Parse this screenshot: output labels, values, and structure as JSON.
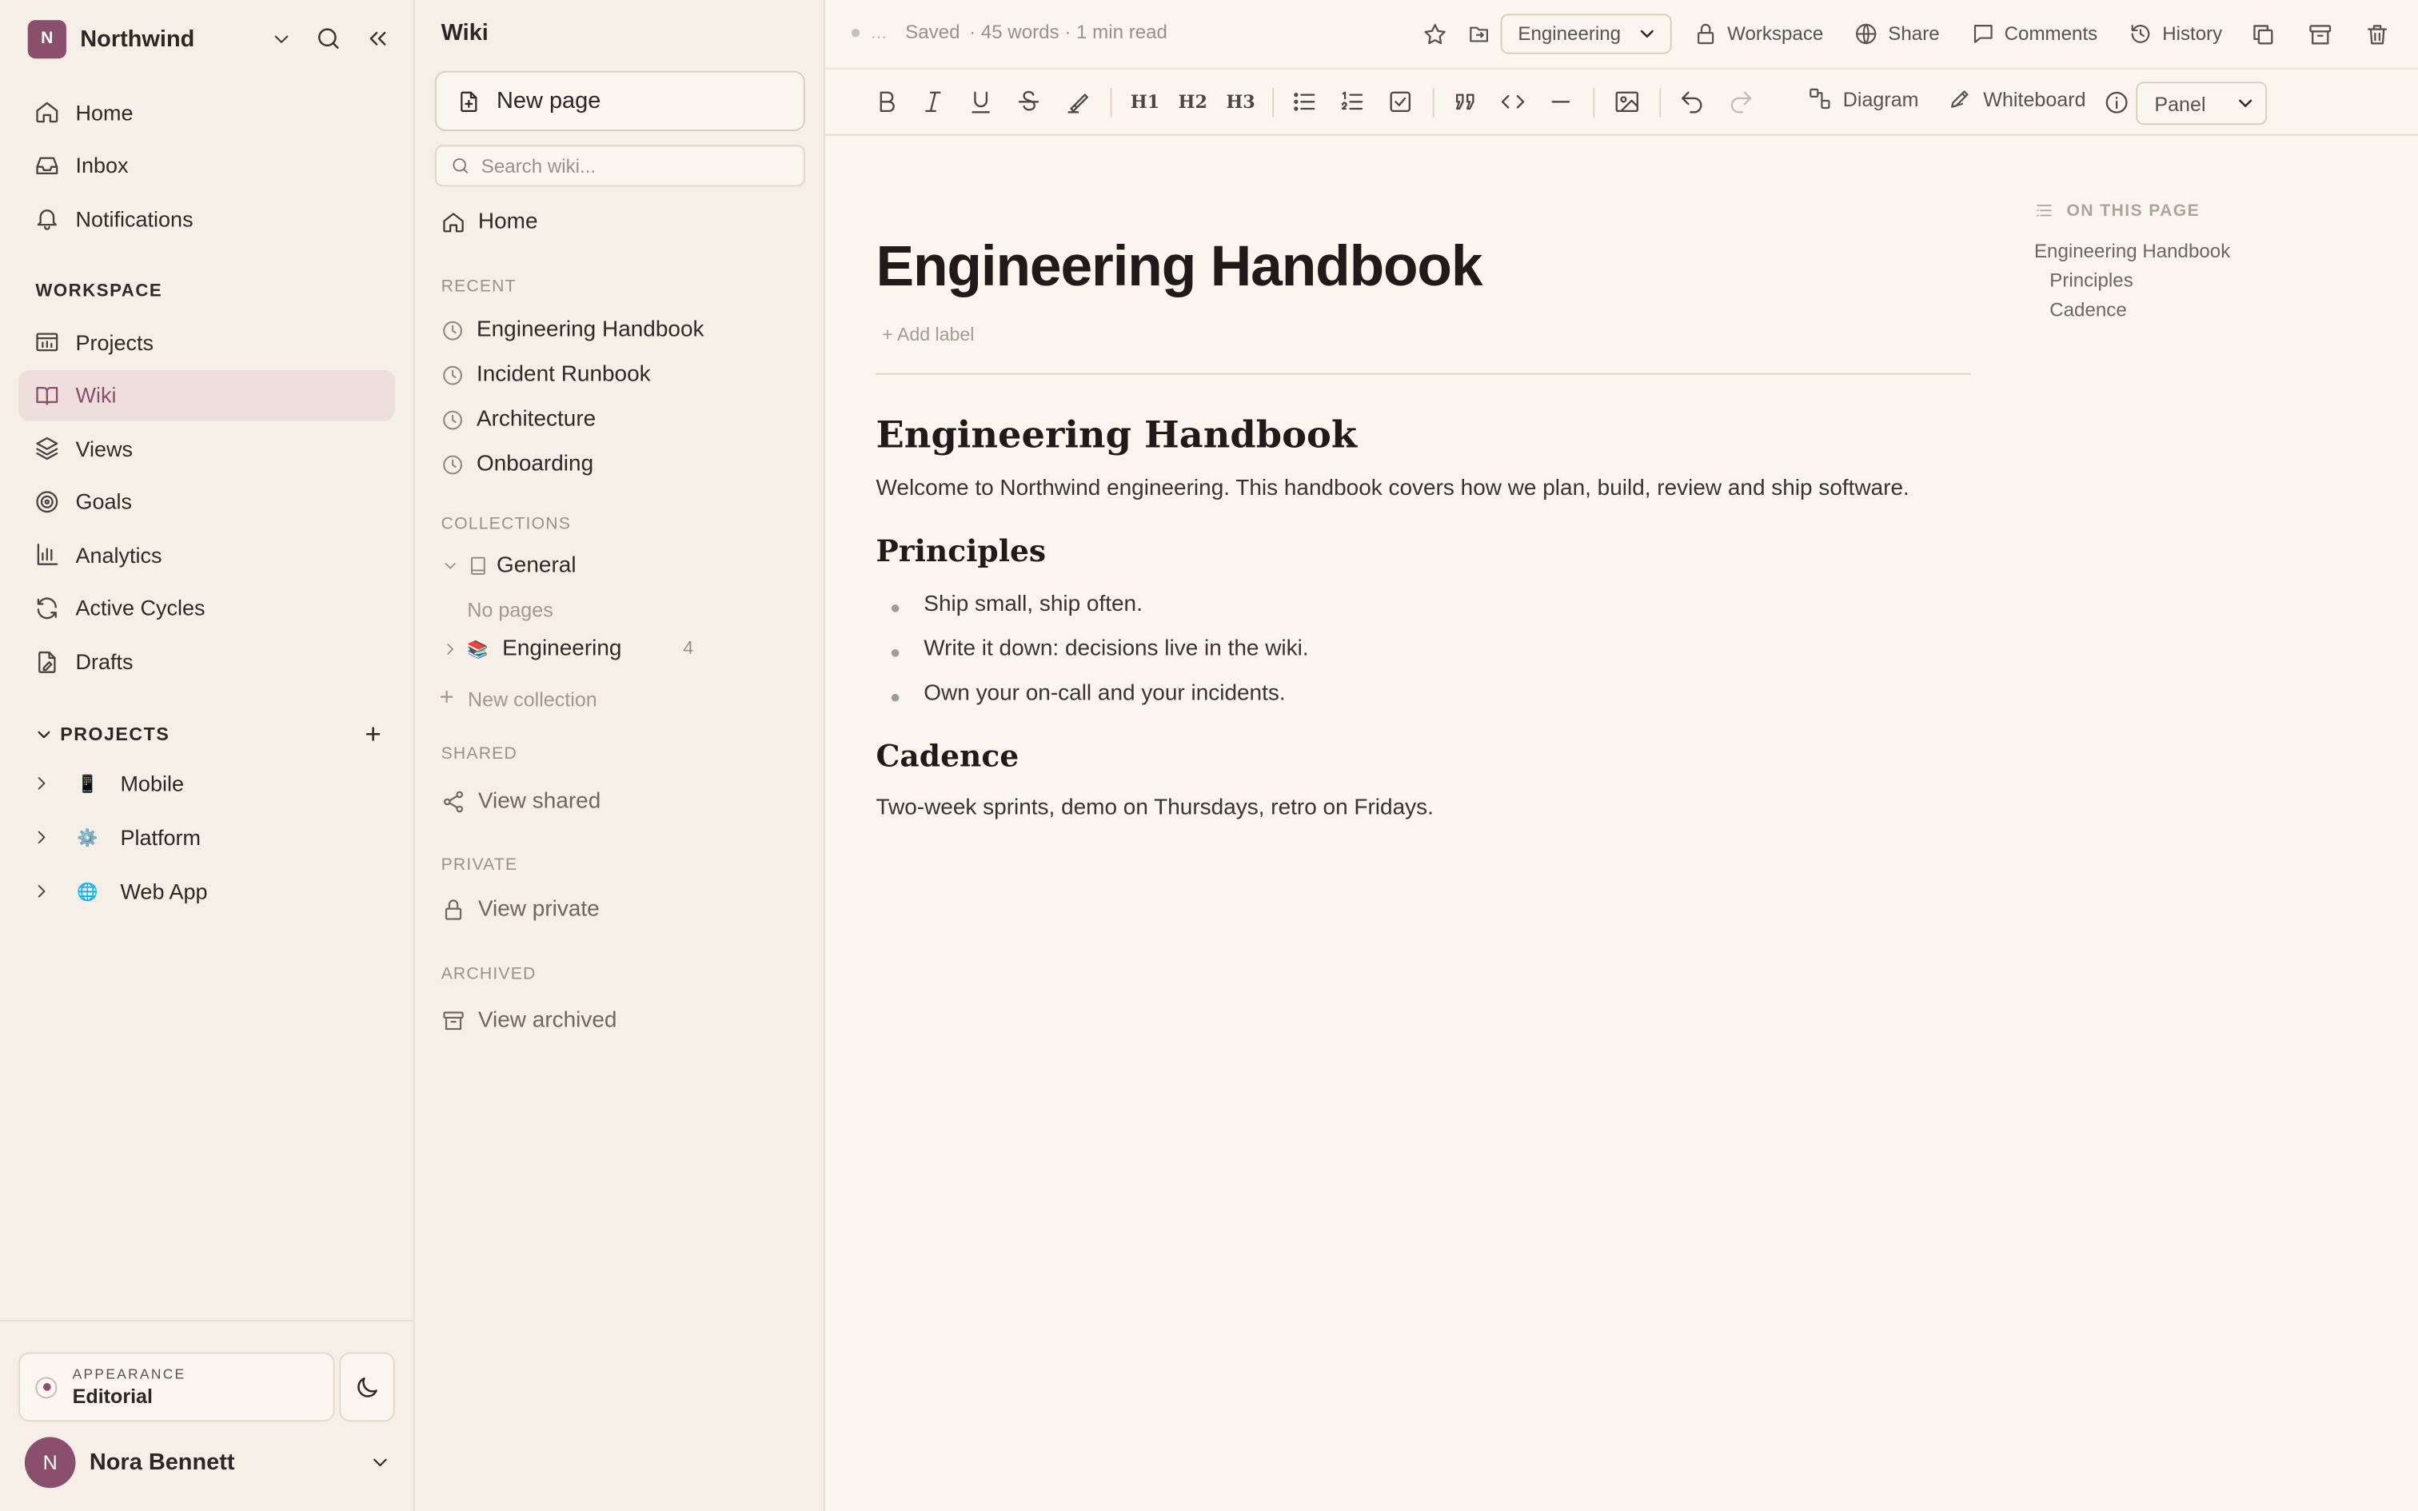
{
  "workspace": {
    "logo_letter": "N",
    "name": "Northwind"
  },
  "nav": {
    "items": [
      {
        "label": "Home",
        "icon": "home-icon"
      },
      {
        "label": "Inbox",
        "icon": "inbox-icon"
      },
      {
        "label": "Notifications",
        "icon": "bell-icon"
      }
    ],
    "workspace_label": "WORKSPACE",
    "workspace_items": [
      {
        "label": "Projects",
        "icon": "projects-icon"
      },
      {
        "label": "Wiki",
        "icon": "book-icon",
        "active": true
      },
      {
        "label": "Views",
        "icon": "layers-icon"
      },
      {
        "label": "Goals",
        "icon": "target-icon"
      },
      {
        "label": "Analytics",
        "icon": "bar-chart-icon"
      },
      {
        "label": "Active Cycles",
        "icon": "refresh-icon"
      },
      {
        "label": "Drafts",
        "icon": "draft-icon"
      }
    ],
    "projects_label": "PROJECTS",
    "projects": [
      {
        "name": "Mobile",
        "emoji": "📱"
      },
      {
        "name": "Platform",
        "emoji": "⚙️"
      },
      {
        "name": "Web App",
        "emoji": "🌐"
      }
    ]
  },
  "appearance": {
    "label": "APPEARANCE",
    "value": "Editorial"
  },
  "user": {
    "initial": "N",
    "name": "Nora Bennett"
  },
  "wiki": {
    "title": "Wiki",
    "new_page": "New page",
    "search_placeholder": "Search wiki...",
    "home": "Home",
    "recent_label": "RECENT",
    "recent": [
      "Engineering Handbook",
      "Incident Runbook",
      "Architecture",
      "Onboarding"
    ],
    "collections_label": "COLLECTIONS",
    "collections": [
      {
        "name": "General",
        "empty": "No pages",
        "expanded": true
      },
      {
        "name": "Engineering",
        "emoji": "📚",
        "count": "4"
      }
    ],
    "new_collection": "New collection",
    "shared_label": "SHARED",
    "shared": "View shared",
    "private_label": "PRIVATE",
    "private": "View private",
    "archived_label": "ARCHIVED",
    "archived": "View archived"
  },
  "topbar": {
    "dots": "...",
    "saved": "Saved",
    "stats": "· 45 words · 1 min read",
    "collection_select": "Engineering",
    "workspace": "Workspace",
    "share": "Share",
    "comments": "Comments",
    "history": "History"
  },
  "toolbar": {
    "h1": "H1",
    "h2": "H2",
    "h3": "H3",
    "diagram": "Diagram",
    "whiteboard": "Whiteboard",
    "panel_select": "Panel"
  },
  "doc": {
    "title": "Engineering Handbook",
    "add_label": "+ Add label",
    "heading": "Engineering Handbook",
    "intro": "Welcome to Northwind engineering. This handbook covers how we plan, build, review and ship software.",
    "principles_heading": "Principles",
    "principles": [
      "Ship small, ship often.",
      "Write it down: decisions live in the wiki.",
      "Own your on-call and your incidents."
    ],
    "cadence_heading": "Cadence",
    "cadence": "Two-week sprints, demo on Thursdays, retro on Fridays."
  },
  "toc": {
    "label": "ON THIS PAGE",
    "items": [
      "Engineering Handbook",
      "Principles",
      "Cadence"
    ]
  }
}
